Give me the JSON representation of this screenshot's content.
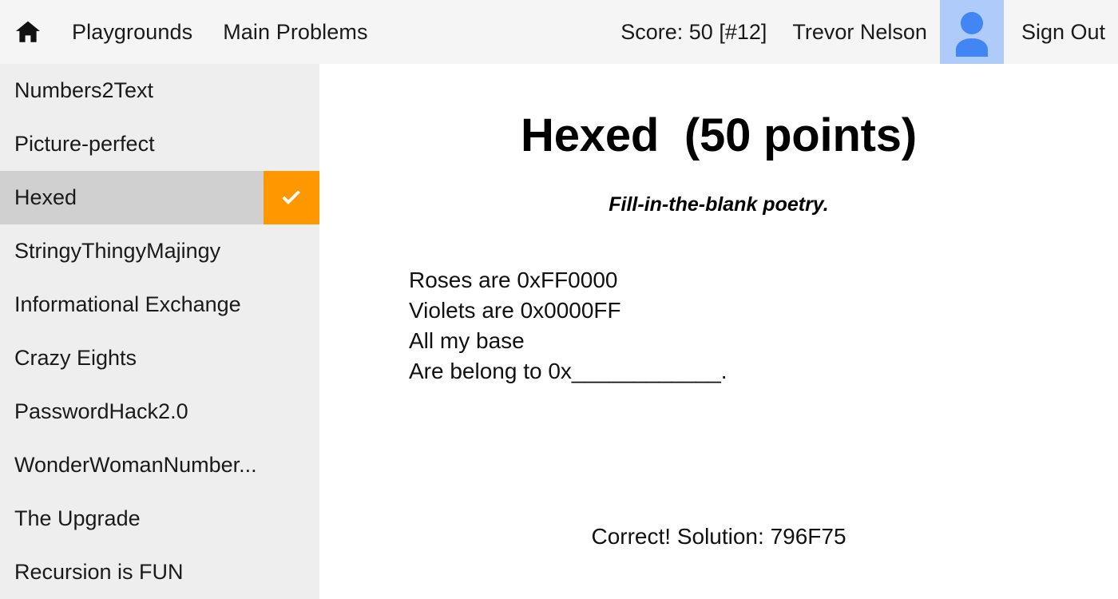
{
  "topbar": {
    "home_icon": "home-icon",
    "links": [
      {
        "label": "Playgrounds"
      },
      {
        "label": "Main Problems"
      }
    ],
    "score_text": "Score: 50 [#12]",
    "user_name": "Trevor Nelson",
    "avatar_icon": "user-avatar-icon",
    "avatar_bg": "#aecbfa",
    "avatar_fg": "#4285f4",
    "sign_out_label": "Sign Out",
    "background": "#f5f5f5"
  },
  "sidebar": {
    "background": "#eeeeee",
    "active_background": "#d0d0d0",
    "check_badge_color": "#ff9800",
    "items": [
      {
        "label": "Numbers2Text",
        "active": false,
        "solved": false
      },
      {
        "label": "Picture-perfect",
        "active": false,
        "solved": false
      },
      {
        "label": "Hexed",
        "active": true,
        "solved": true
      },
      {
        "label": "StringyThingyMajingy",
        "active": false,
        "solved": false
      },
      {
        "label": "Informational Exchange",
        "active": false,
        "solved": false
      },
      {
        "label": "Crazy Eights",
        "active": false,
        "solved": false
      },
      {
        "label": "PasswordHack2.0",
        "active": false,
        "solved": false
      },
      {
        "label": "WonderWomanNumber...",
        "active": false,
        "solved": false
      },
      {
        "label": "The Upgrade",
        "active": false,
        "solved": false
      },
      {
        "label": "Recursion is FUN",
        "active": false,
        "solved": false
      }
    ]
  },
  "main": {
    "title": "Hexed  (50 points)",
    "subtitle": "Fill-in-the-blank poetry.",
    "poem": "Roses are 0xFF0000\nViolets are 0x0000FF\nAll my base\nAre belong to 0x____________.",
    "result_text": "Correct! Solution: 796F75"
  }
}
